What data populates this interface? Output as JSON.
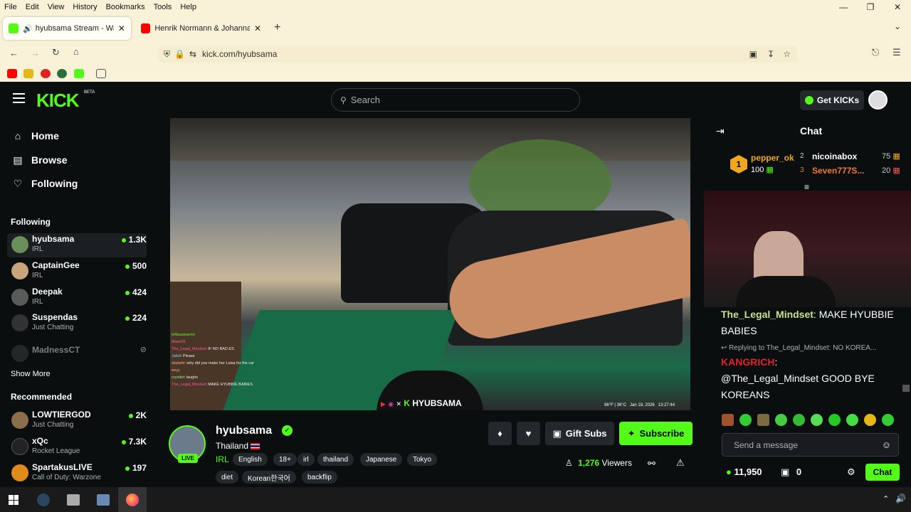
{
  "browser": {
    "menu": [
      "File",
      "Edit",
      "View",
      "History",
      "Bookmarks",
      "Tools",
      "Help"
    ],
    "tabs": [
      {
        "label": "hyubsama Stream - Watch",
        "active": true
      },
      {
        "label": "Henrik Normann & Johanna - K",
        "active": false
      }
    ],
    "url": "kick.com/hyubsama"
  },
  "header": {
    "logo": "KICK",
    "logo_badge": "BETA",
    "search_placeholder": "Search",
    "get_kicks": "Get KICKs"
  },
  "sidebar": {
    "nav": [
      {
        "label": "Home",
        "icon": "home-icon"
      },
      {
        "label": "Browse",
        "icon": "browse-icon"
      },
      {
        "label": "Following",
        "icon": "heart-icon"
      }
    ],
    "following_title": "Following",
    "following": [
      {
        "name": "hyubsama",
        "category": "IRL",
        "viewers": "1.3K",
        "color": "#6a8f5a"
      },
      {
        "name": "CaptainGee",
        "category": "IRL",
        "viewers": "500",
        "color": "#c9a57a"
      },
      {
        "name": "Deepak",
        "category": "IRL",
        "viewers": "424",
        "color": "#5a5a5a"
      },
      {
        "name": "Suspendas",
        "category": "Just Chatting",
        "viewers": "224",
        "color": "#333"
      },
      {
        "name": "MadnessCT",
        "category": "",
        "viewers": "",
        "color": "#444"
      }
    ],
    "show_more": "Show More",
    "recommended_title": "Recommended",
    "recommended": [
      {
        "name": "LOWTIERGOD",
        "category": "Just Chatting",
        "viewers": "2K",
        "color": "#8a6d4a"
      },
      {
        "name": "xQc",
        "category": "Rocket League",
        "viewers": "7.3K",
        "color": "#222"
      },
      {
        "name": "SpartakusLIVE",
        "category": "Call of Duty: Warzone",
        "viewers": "197",
        "color": "#e08a1a"
      }
    ]
  },
  "video": {
    "overlay_name": "HYUBSAMA",
    "overlay_status": "96°F | 36°C   Jan 18, 2026   13:27:44",
    "chat_overlay": [
      {
        "user": "leftbaawarrior",
        "msg": ""
      },
      {
        "user": "Masri25",
        "msg": ""
      },
      {
        "user": "The_Legal_Mindset",
        "msg": "IF NO BAD ES"
      },
      {
        "user": "Jakid",
        "msg": "Please"
      },
      {
        "user": "skylarkl",
        "msg": "why did you make her Luisa for the car"
      },
      {
        "user": "eeyy",
        "msg": ""
      },
      {
        "user": "cryzdet",
        "msg": "laughs"
      },
      {
        "user": "The_Legal_Mindset",
        "msg": "MAKE HYUBBIE BABIES"
      }
    ]
  },
  "stream": {
    "streamer": "hyubsama",
    "live_label": "LIVE",
    "location": "Thailand",
    "category": "IRL",
    "tags": [
      "English",
      "18+",
      "irl",
      "thailand",
      "Japanese",
      "Tokyo"
    ],
    "tags2": [
      "diet",
      "Korean한국어",
      "backflip"
    ],
    "gift_subs": "Gift Subs",
    "subscribe": "Subscribe",
    "viewers": "1,276",
    "viewers_label": "Viewers"
  },
  "chat": {
    "title": "Chat",
    "leaderboard": [
      {
        "rank": "1",
        "name": "pepper_ok",
        "amount": "100"
      },
      {
        "rank": "2",
        "name": "nicoinabox",
        "amount": "75"
      },
      {
        "rank": "3",
        "name": "Seven777S...",
        "amount": "20"
      }
    ],
    "messages": [
      {
        "user": "The_Legal_Mindset",
        "user_color": "#c8e08a",
        "text": "MAKE HYUBBIE BABIES"
      },
      {
        "reply": "Replying to The_Legal_Mindset: NO KOREA...",
        "user": "KANGRICH",
        "user_color": "#e0242a",
        "text": "@The_Legal_Mindset GOOD BYE KOREANS"
      }
    ],
    "input_placeholder": "Send a message",
    "points": "11,950",
    "gift_count": "0",
    "send_label": "Chat"
  }
}
